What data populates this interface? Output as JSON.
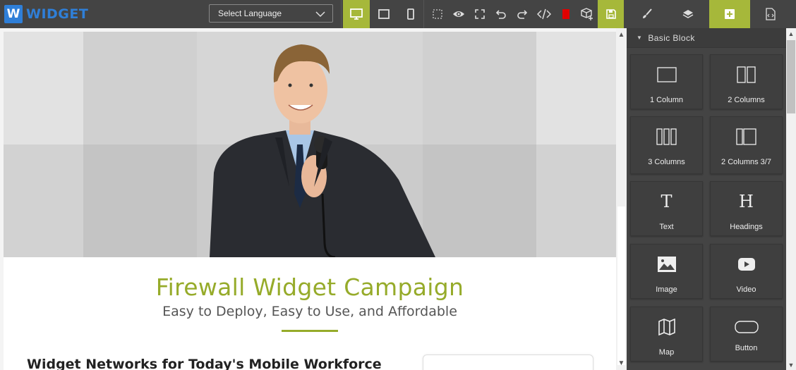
{
  "app": {
    "logo_letter": "W",
    "logo_text": "WIDGET",
    "brand_color": "#2f7fd8",
    "accent_color": "#a6b83a"
  },
  "toolbar": {
    "language_select": {
      "value": "Select Language"
    },
    "device_buttons": [
      {
        "name": "desktop-icon",
        "active": true
      },
      {
        "name": "tablet-icon",
        "active": false
      },
      {
        "name": "mobile-icon",
        "active": false
      }
    ],
    "action_buttons": [
      "outline-icon",
      "preview-eye-icon",
      "fullscreen-icon",
      "undo-icon",
      "redo-icon",
      "code-icon",
      "clear-canvas-icon",
      "import-icon",
      "save-icon"
    ],
    "panel_tabs": [
      {
        "name": "style-manager-brush-icon",
        "active": false
      },
      {
        "name": "layer-manager-icon",
        "active": false
      },
      {
        "name": "blocks-plus-icon",
        "active": true
      },
      {
        "name": "page-code-icon",
        "active": false
      }
    ]
  },
  "canvas": {
    "hero_title": "Firewall Widget Campaign",
    "hero_subtitle": "Easy to Deploy, Easy to Use, and Affordable",
    "section_title": "Widget Networks for Today's Mobile Workforce",
    "title_color": "#96ab2a"
  },
  "blocks_panel": {
    "category": "Basic Block",
    "blocks": [
      {
        "label": "1 Column",
        "icon": "one-column-icon"
      },
      {
        "label": "2 Columns",
        "icon": "two-columns-icon"
      },
      {
        "label": "3 Columns",
        "icon": "three-columns-icon"
      },
      {
        "label": "2 Columns 3/7",
        "icon": "two-columns-3-7-icon"
      },
      {
        "label": "Text",
        "icon": "text-icon"
      },
      {
        "label": "Headings",
        "icon": "headings-icon"
      },
      {
        "label": "Image",
        "icon": "image-icon"
      },
      {
        "label": "Video",
        "icon": "video-icon"
      },
      {
        "label": "Map",
        "icon": "map-icon"
      },
      {
        "label": "Button",
        "icon": "button-icon"
      }
    ]
  }
}
